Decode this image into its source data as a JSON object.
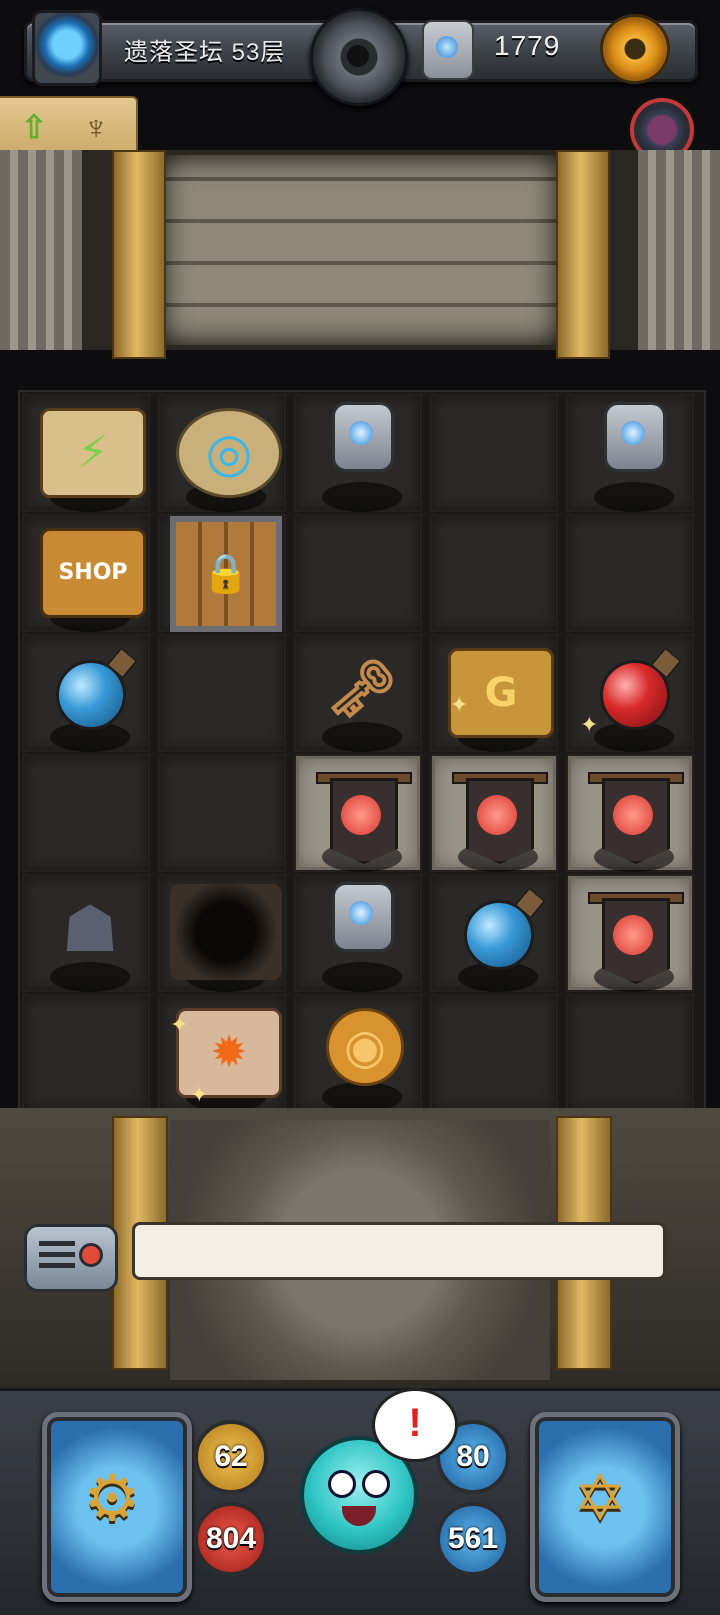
{
  "top_bar": {
    "floor_label": "遗落圣坛 53层",
    "gem_count": "1779"
  },
  "upgrade_panel": {
    "arrow_glyph": "⇧",
    "altar_glyph": "♆"
  },
  "board": {
    "rows": 6,
    "cols": 5,
    "items": [
      {
        "name": "lightning-scroll",
        "row": 0,
        "col": 0,
        "glyph": "⚡"
      },
      {
        "name": "portal-stairs",
        "row": 0,
        "col": 1,
        "glyph": "◎"
      },
      {
        "name": "blue-gem-stone",
        "row": 0,
        "col": 2
      },
      {
        "name": "blue-gem-stone",
        "row": 0,
        "col": 4
      },
      {
        "name": "shop-building",
        "row": 1,
        "col": 0,
        "glyph": "SHOP"
      },
      {
        "name": "locked-door",
        "row": 1,
        "col": 1,
        "glyph": "🔒"
      },
      {
        "name": "blue-potion",
        "row": 2,
        "col": 0
      },
      {
        "name": "bronze-key",
        "row": 2,
        "col": 2,
        "glyph": "🗝"
      },
      {
        "name": "gold-bag",
        "row": 2,
        "col": 3,
        "glyph": "G"
      },
      {
        "name": "red-potion",
        "row": 2,
        "col": 4
      },
      {
        "name": "enemy-banner",
        "row": 3,
        "col": 2
      },
      {
        "name": "enemy-banner",
        "row": 3,
        "col": 3
      },
      {
        "name": "enemy-banner",
        "row": 3,
        "col": 4
      },
      {
        "name": "blue-gem-stone",
        "row": 4,
        "col": 2
      },
      {
        "name": "blue-potion",
        "row": 4,
        "col": 3
      },
      {
        "name": "enemy-banner",
        "row": 4,
        "col": 4
      },
      {
        "name": "stone-golem",
        "row": 4,
        "col": 0,
        "glyph": "☗"
      },
      {
        "name": "floor-hole",
        "row": 4,
        "col": 1
      },
      {
        "name": "fire-rune-stone",
        "row": 5,
        "col": 1,
        "glyph": "✹"
      },
      {
        "name": "bronze-coin",
        "row": 5,
        "col": 2,
        "glyph": "◉"
      }
    ],
    "lit_cells": [
      [
        3,
        2
      ],
      [
        3,
        3
      ],
      [
        3,
        4
      ],
      [
        4,
        4
      ]
    ]
  },
  "dialog": {
    "message": ""
  },
  "hud": {
    "attack": "62",
    "health": "804",
    "defense": "80",
    "mana": "561",
    "alert_glyph": "!",
    "armor_glyph": "⚙",
    "book_glyph": "✡"
  }
}
